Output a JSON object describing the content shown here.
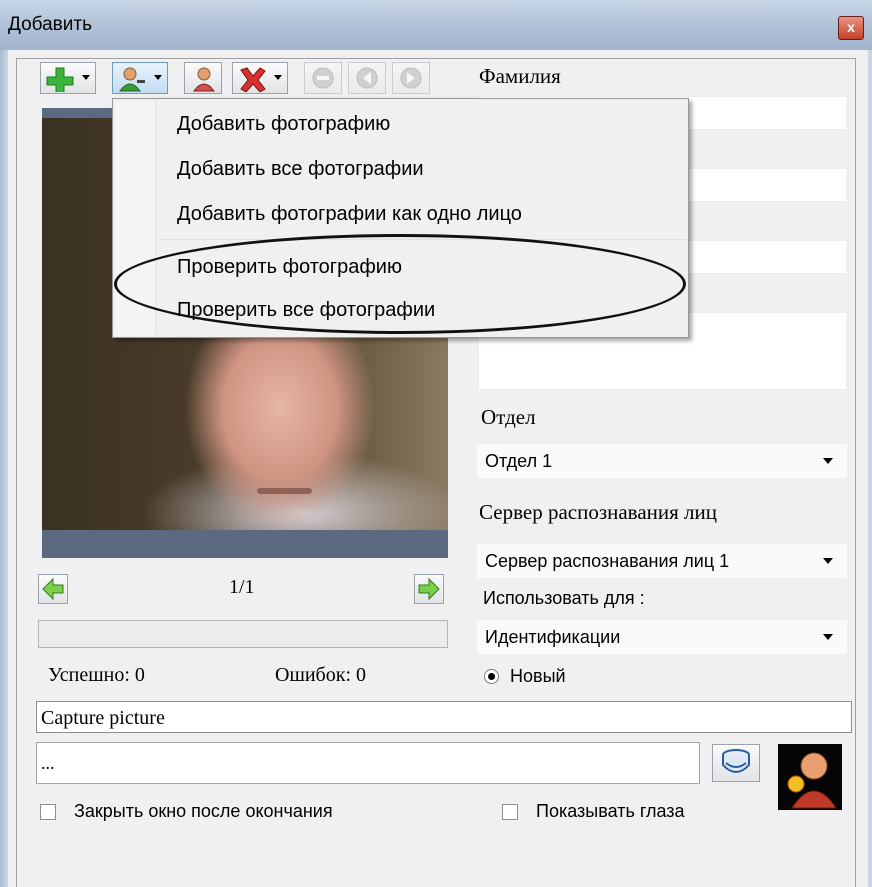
{
  "window": {
    "title": "Добавить",
    "close_label": "x"
  },
  "toolbar": {
    "buttons": [
      {
        "name": "add-person-button",
        "icon": "green-plus-icon",
        "has_dropdown": true
      },
      {
        "name": "add-photo-button",
        "icon": "user-icon",
        "has_dropdown": true
      },
      {
        "name": "person-button",
        "icon": "person-icon",
        "has_dropdown": false
      },
      {
        "name": "delete-button",
        "icon": "red-x-icon",
        "has_dropdown": true
      },
      {
        "name": "remove-button",
        "icon": "minus-circle-icon",
        "disabled": true
      },
      {
        "name": "back-button",
        "icon": "arrow-left-circle-icon",
        "disabled": true
      },
      {
        "name": "forward-button",
        "icon": "arrow-right-circle-icon",
        "disabled": true
      }
    ]
  },
  "dropdown_menu": {
    "items": [
      "Добавить фотографию",
      "Добавить все фотографии",
      "Добавить фотографии как одно лицо",
      "Проверить фотографию",
      "Проверить все фотографии"
    ]
  },
  "form": {
    "surname_label": "Фамилия",
    "department_label": "Отдел",
    "department_value": "Отдел 1",
    "server_label": "Сервер распознавания лиц",
    "server_value": "Сервер распознавания лиц 1",
    "use_for_label": "Использовать для :",
    "use_for_value": "Идентификации",
    "radio_new_label": "Новый"
  },
  "photo_nav": {
    "counter": "1/1"
  },
  "stats": {
    "success": "Успешно: 0",
    "errors": "Ошибок: 0"
  },
  "capture": {
    "value": "Capture picture"
  },
  "path": {
    "value": "..."
  },
  "options": {
    "close_after_label": "Закрыть окно после окончания",
    "show_eyes_label": "Показывать глаза"
  },
  "colors": {
    "accent_green": "#3cb43c",
    "menu_bg": "#f0f0f0",
    "photo_frame": "#5b6a80"
  }
}
